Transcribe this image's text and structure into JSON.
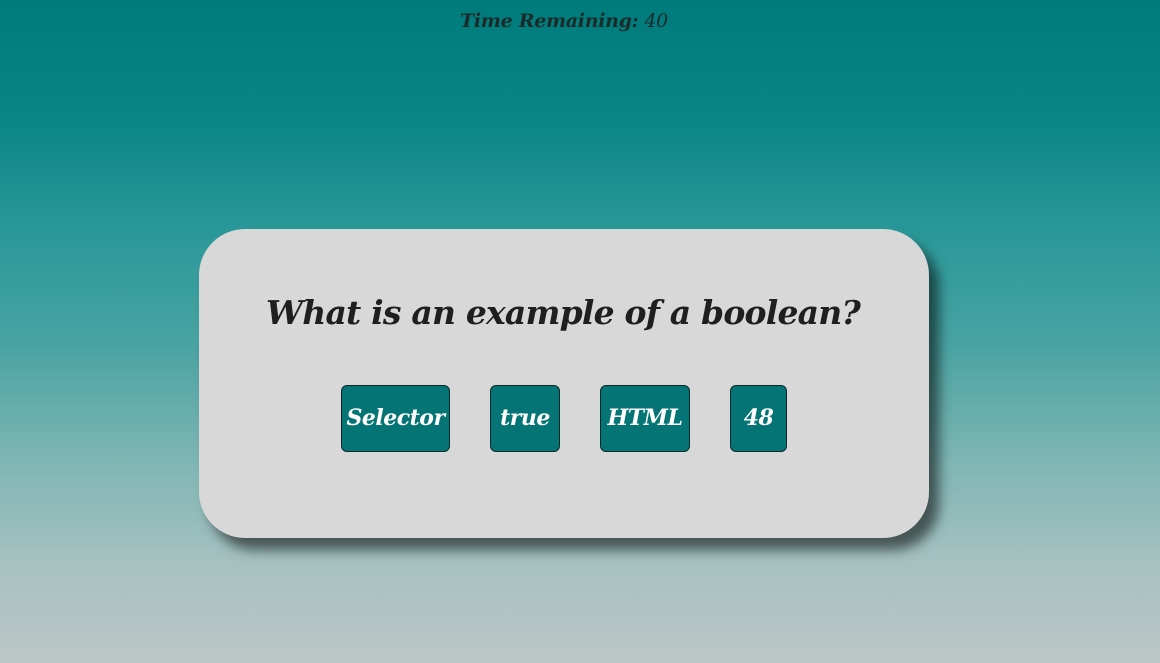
{
  "timer": {
    "label": "Time Remaining:",
    "value": "40"
  },
  "quiz": {
    "question": "What is an example of a boolean?",
    "answers": [
      {
        "label": "Selector"
      },
      {
        "label": "true"
      },
      {
        "label": "HTML"
      },
      {
        "label": "48"
      }
    ]
  },
  "colors": {
    "background_top": "#007b7b",
    "background_bottom": "#bcc6c6",
    "card": "#d8d8d8",
    "button": "#047574",
    "button_text": "#ffffff"
  }
}
